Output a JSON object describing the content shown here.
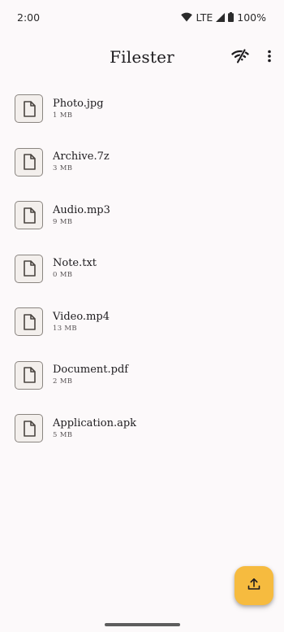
{
  "status_bar": {
    "time": "2:00",
    "network": "LTE",
    "battery": "100%",
    "icons": [
      "wifi-icon",
      "cellular-signal-icon",
      "battery-icon"
    ]
  },
  "app_bar": {
    "title": "Filester",
    "actions": [
      "wifi-sharing-icon",
      "more-vert-icon"
    ]
  },
  "files": [
    {
      "name": "Photo.jpg",
      "size": "1 MB",
      "icon": "file-icon"
    },
    {
      "name": "Archive.7z",
      "size": "3 MB",
      "icon": "file-icon"
    },
    {
      "name": "Audio.mp3",
      "size": "9 MB",
      "icon": "file-icon"
    },
    {
      "name": "Note.txt",
      "size": "0 MB",
      "icon": "file-icon"
    },
    {
      "name": "Video.mp4",
      "size": "13 MB",
      "icon": "file-icon"
    },
    {
      "name": "Document.pdf",
      "size": "2 MB",
      "icon": "file-icon"
    },
    {
      "name": "Application.apk",
      "size": "5 MB",
      "icon": "file-icon"
    }
  ],
  "fab": {
    "icon": "upload-icon",
    "color": "#f6bb3f"
  },
  "colors": {
    "background": "#fcf9fa",
    "text": "#1d1b1e",
    "accent": "#f6bb3f"
  }
}
